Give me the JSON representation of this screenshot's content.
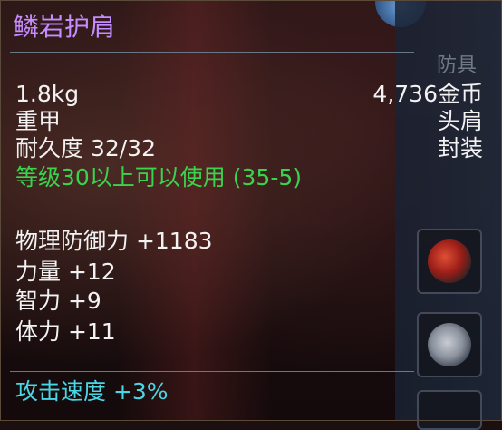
{
  "item": {
    "name": "鳞岩护肩",
    "weight": "1.8kg",
    "price": "4,736金币",
    "armor_type": "重甲",
    "slot": "头肩",
    "durability": "耐久度 32/32",
    "bind_status": "封装",
    "level_req": "等级30以上可以使用 (35-5)",
    "stats": [
      {
        "text": "物理防御力 +1183"
      },
      {
        "text": "力量 +12"
      },
      {
        "text": "智力 +9"
      },
      {
        "text": "体力 +11"
      }
    ],
    "bonus": "攻击速度 +3%"
  },
  "background": {
    "tab_label": "防具"
  },
  "colors": {
    "title": "#c48cff",
    "requirement": "#39d34e",
    "bonus": "#49d7e6",
    "normal": "#f2f2f2"
  }
}
